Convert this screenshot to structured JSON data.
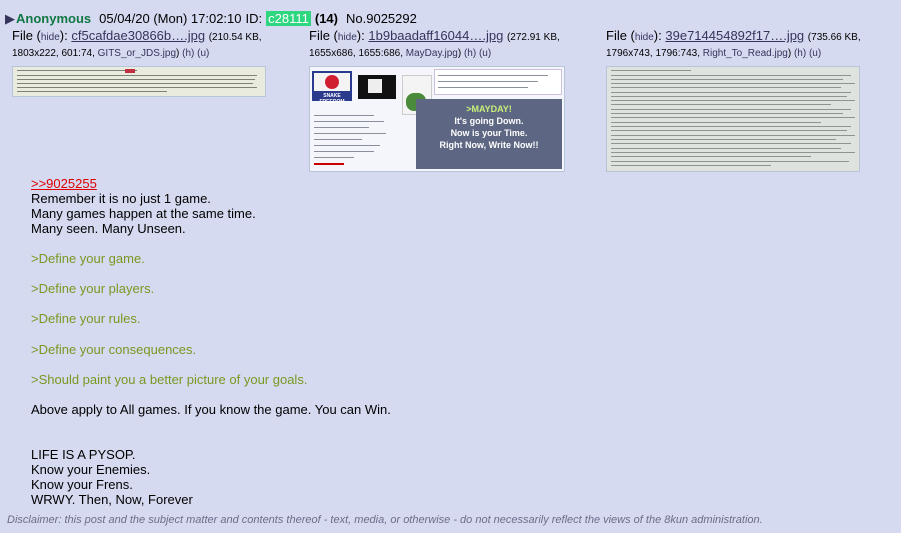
{
  "header": {
    "name": "Anonymous",
    "datetime": "05/04/20 (Mon) 17:02:10",
    "id_label": "ID:",
    "id_value": "c28111",
    "reply_count": "(14)",
    "post_no": "No.9025292"
  },
  "files": [
    {
      "file_label": "File (",
      "hide_label": "hide",
      "after_hide": "):",
      "filename": "cf5cafdae30866b….jpg",
      "size": "(210.54 KB,",
      "dims": "1803x222, 601:74,",
      "original_name": "GITS_or_JDS.jpg",
      "close_paren": ")",
      "h_label": "(h)",
      "u_label": "(u)"
    },
    {
      "file_label": "File (",
      "hide_label": "hide",
      "after_hide": "):",
      "filename": "1b9baadaff16044….jpg",
      "size": "(272.91 KB,",
      "dims": "1655x686, 1655:686,",
      "original_name": "MayDay.jpg",
      "close_paren": ")",
      "h_label": "(h)",
      "u_label": "(u)"
    },
    {
      "file_label": "File (",
      "hide_label": "hide",
      "after_hide": "):",
      "filename": "39e714454892f17….jpg",
      "size": "(735.66 KB,",
      "dims": "1796x743, 1796:743,",
      "original_name": "Right_To_Read.jpg",
      "close_paren": ")",
      "h_label": "(h)",
      "u_label": "(u)"
    }
  ],
  "thumb_text": {
    "mayday": [
      ">MAYDAY!",
      "It's going Down.",
      "Now is your Time.",
      "Right Now, Write Now!!"
    ],
    "banner": "SNAKE FREEDOM"
  },
  "body": {
    "quote_link": ">>9025255",
    "lines1": [
      "Remember it is no just 1 game.",
      "Many games happen at the same time.",
      "Many seen. Many Unseen."
    ],
    "greentext": [
      ">Define your game.",
      ">Define your players.",
      ">Define your rules.",
      ">Define your consequences.",
      ">Should paint you a better picture of your goals."
    ],
    "summary": "Above apply to All games. If you know the game. You can Win.",
    "lines2": [
      "LIFE IS A PYSOP.",
      "Know your Enemies.",
      "Know your Frens.",
      "WRWY. Then, Now, Forever"
    ]
  },
  "disclaimer": "Disclaimer: this post and the subject matter and contents thereof - text, media, or otherwise - do not necessarily reflect the views of the 8kun administration.",
  "colors": {
    "background": "#d6daf0",
    "name": "#117743",
    "id_badge": "#2fd680",
    "link": "#34345c",
    "quote_link": "#dd0000",
    "greentext": "#789922"
  },
  "icons": {
    "post_arrow": "triangle-right-icon"
  }
}
